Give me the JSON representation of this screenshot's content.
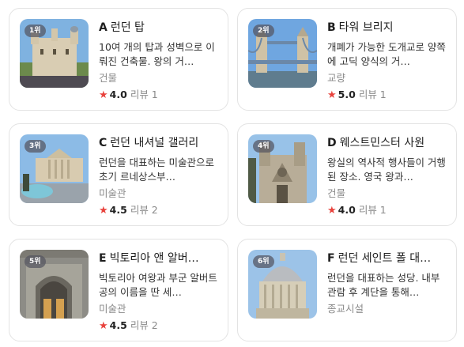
{
  "places": [
    {
      "rank": "1위",
      "letter": "A",
      "name": "런던 탑",
      "desc": "10여 개의 탑과 성벽으로 이뤄진 건축물. 왕의 거…",
      "category": "건물",
      "star": "★",
      "score": "4.0",
      "reviews": "리뷰 1"
    },
    {
      "rank": "2위",
      "letter": "B",
      "name": "타워 브리지",
      "desc": "개폐가 가능한 도개교로 양쪽에 고딕 양식의 거…",
      "category": "교량",
      "star": "★",
      "score": "5.0",
      "reviews": "리뷰 1"
    },
    {
      "rank": "3위",
      "letter": "C",
      "name": "런던 내셔널 갤러리",
      "desc": "런던을 대표하는 미술관으로 초기 르네상스부…",
      "category": "미술관",
      "star": "★",
      "score": "4.5",
      "reviews": "리뷰 2"
    },
    {
      "rank": "4위",
      "letter": "D",
      "name": "웨스트민스터 사원",
      "desc": "왕실의 역사적 행사들이 거행된 장소. 영국 왕과…",
      "category": "건물",
      "star": "★",
      "score": "4.0",
      "reviews": "리뷰 1"
    },
    {
      "rank": "5위",
      "letter": "E",
      "name": "빅토리아 앤 알버…",
      "desc": "빅토리아 여왕과 부군 알버트 공의 이름을 딴 세…",
      "category": "미술관",
      "star": "★",
      "score": "4.5",
      "reviews": "리뷰 2"
    },
    {
      "rank": "6위",
      "letter": "F",
      "name": "런던 세인트 폴 대…",
      "desc": "런던을 대표하는 성당. 내부 관람 후 계단을 통해…",
      "category": "종교시설",
      "star": "",
      "score": "",
      "reviews": ""
    }
  ],
  "colors": {
    "star": "#e8423c",
    "border": "#e3e3e3",
    "category": "#8a8a8a"
  }
}
